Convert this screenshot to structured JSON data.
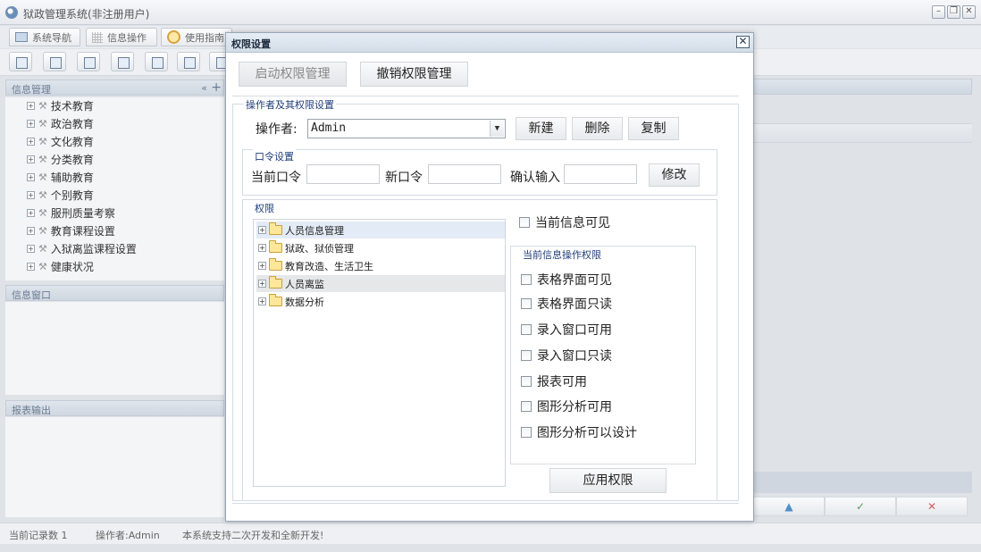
{
  "app": {
    "title": "狱政管理系统(非注册用户)"
  },
  "tabs": [
    "系统导航",
    "信息操作",
    "使用指南"
  ],
  "left": {
    "info_manage_title": "信息管理",
    "tree_items": [
      "技术教育",
      "政治教育",
      "文化教育",
      "分类教育",
      "辅助教育",
      "个别教育",
      "服刑质量考察",
      "教育课程设置",
      "入狱离监课程设置",
      "健康状况"
    ],
    "info_window_title": "信息窗口",
    "report_title": "报表输出"
  },
  "right_buttons": [
    "▲",
    "✓",
    "✕"
  ],
  "status": {
    "records": "当前记录数 1",
    "operator": "操作者:Admin",
    "note": "本系统支持二次开发和全新开发!"
  },
  "dialog": {
    "title": "权限设置",
    "enable_btn": "启动权限管理",
    "revoke_btn": "撤销权限管理",
    "op_group_label": "操作者及其权限设置",
    "operator_label": "操作者:",
    "operator_value": "Admin",
    "new_btn": "新建",
    "delete_btn": "删除",
    "copy_btn": "复制",
    "pwd_group_label": "口令设置",
    "current_pwd_label": "当前口令",
    "new_pwd_label": "新口令",
    "confirm_label": "确认输入",
    "modify_btn": "修改",
    "perm_group_label": "权限",
    "perm_nodes": [
      "人员信息管理",
      "狱政、狱侦管理",
      "教育改造、生活卫生",
      "人员离监",
      "数据分析"
    ],
    "visible_label": "当前信息可见",
    "ops_group_label": "当前信息操作权限",
    "ops": [
      "表格界面可见",
      "表格界面只读",
      "录入窗口可用",
      "录入窗口只读",
      "报表可用",
      "图形分析可用",
      "图形分析可以设计"
    ],
    "apply_btn": "应用权限"
  }
}
